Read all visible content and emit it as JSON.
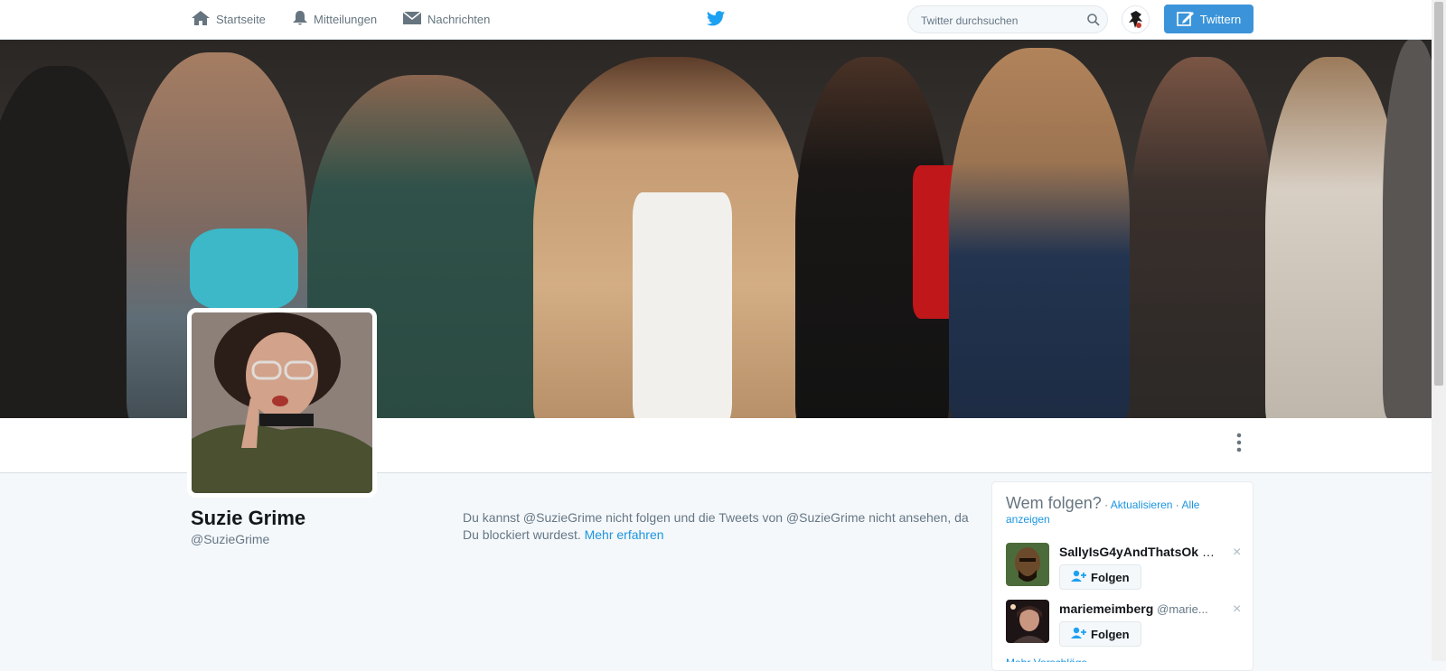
{
  "nav": {
    "home_label": "Startseite",
    "notifications_label": "Mitteilungen",
    "messages_label": "Nachrichten",
    "search_placeholder": "Twitter durchsuchen",
    "tweet_button": "Twittern"
  },
  "profile": {
    "name": "Suzie Grime",
    "handle": "@SuzieGrime"
  },
  "blocked": {
    "message": "Du kannst @SuzieGrime nicht folgen und die Tweets von @SuzieGrime nicht ansehen, da Du blockiert wurdest.",
    "learn_more": "Mehr erfahren"
  },
  "who_to_follow": {
    "title": "Wem folgen?",
    "separator1": " · ",
    "refresh": "Aktualisieren",
    "separator2": " · ",
    "view_all": "Alle anzeigen",
    "suggestions": [
      {
        "name": "SallyIsG4yAndThatsOk",
        "handle": "@...",
        "follow_label": "Folgen",
        "dismiss": "×"
      },
      {
        "name": "mariemeimberg",
        "handle": "@marie...",
        "follow_label": "Folgen",
        "dismiss": "×"
      }
    ],
    "more_link": "Mehr Vorschläge"
  },
  "colors": {
    "accent": "#1b95e0",
    "tweet_button": "#3b94d9",
    "nav_icon": "#66757f",
    "twitter_blue": "#1da1f2"
  },
  "icons": [
    "home-icon",
    "bell-icon",
    "envelope-icon",
    "twitter-bird-icon",
    "search-icon",
    "compose-icon",
    "more-vertical-icon",
    "follow-person-icon",
    "close-icon"
  ]
}
